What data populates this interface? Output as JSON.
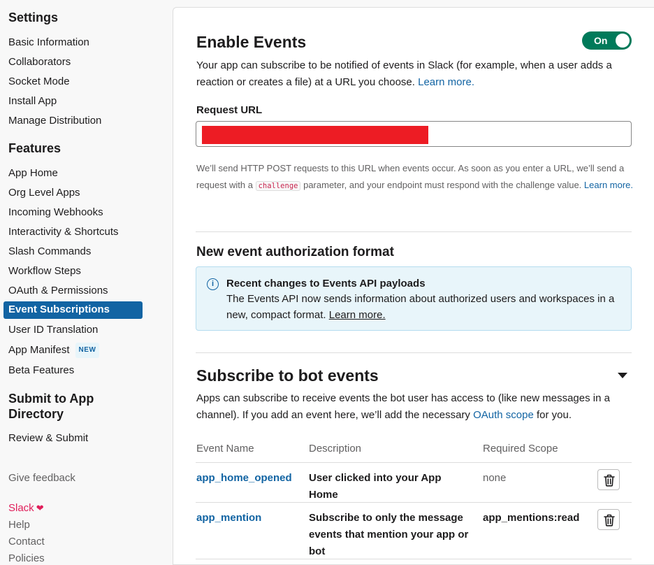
{
  "sidebar": {
    "settings_heading": "Settings",
    "settings_items": [
      "Basic Information",
      "Collaborators",
      "Socket Mode",
      "Install App",
      "Manage Distribution"
    ],
    "features_heading": "Features",
    "features_items": [
      "App Home",
      "Org Level Apps",
      "Incoming Webhooks",
      "Interactivity & Shortcuts",
      "Slash Commands",
      "Workflow Steps",
      "OAuth & Permissions",
      "Event Subscriptions",
      "User ID Translation",
      "App Manifest",
      "Beta Features"
    ],
    "new_badge": "NEW",
    "submit_heading_line1": "Submit to App",
    "submit_heading_line2": "Directory",
    "submit_items": [
      "Review & Submit"
    ],
    "give_feedback": "Give feedback",
    "slack": "Slack",
    "footer_links": [
      "Help",
      "Contact",
      "Policies"
    ]
  },
  "enable_events": {
    "title": "Enable Events",
    "toggle_label": "On",
    "description": "Your app can subscribe to be notified of events in Slack (for example, when a user adds a reaction or creates a file) at a URL you choose.",
    "learn_more": "Learn more.",
    "request_url_label": "Request URL",
    "help_part1": "We’ll send HTTP POST requests to this URL when events occur. As soon as you enter a URL, we’ll send a request with a",
    "help_code": "challenge",
    "help_part2": "parameter, and your endpoint must respond with the challenge value.",
    "help_learn_more": "Learn more."
  },
  "auth_format": {
    "title": "New event authorization format",
    "notice_title": "Recent changes to Events API payloads",
    "notice_body": "The Events API now sends information about authorized users and workspaces in a new, compact format.",
    "notice_link": "Learn more."
  },
  "bot_events": {
    "title": "Subscribe to bot events",
    "description": "Apps can subscribe to receive events the bot user has access to (like new messages in a channel). If you add an event here, we’ll add the necessary",
    "oauth_link": "OAuth scope",
    "description_end": "for you.",
    "columns": [
      "Event Name",
      "Description",
      "Required Scope"
    ],
    "rows": [
      {
        "name": "app_home_opened",
        "description": "User clicked into your App Home",
        "scope": "none"
      },
      {
        "name": "app_mention",
        "description": "Subscribe to only the message events that mention your app or bot",
        "scope": "app_mentions:read"
      }
    ]
  },
  "colors": {
    "accent": "#1264a3",
    "active_nav": "#1264a3",
    "toggle_on": "#007a5a",
    "slack_pink": "#e01e5a",
    "redaction": "#ed1c24",
    "notice_bg": "#e8f5fa"
  }
}
